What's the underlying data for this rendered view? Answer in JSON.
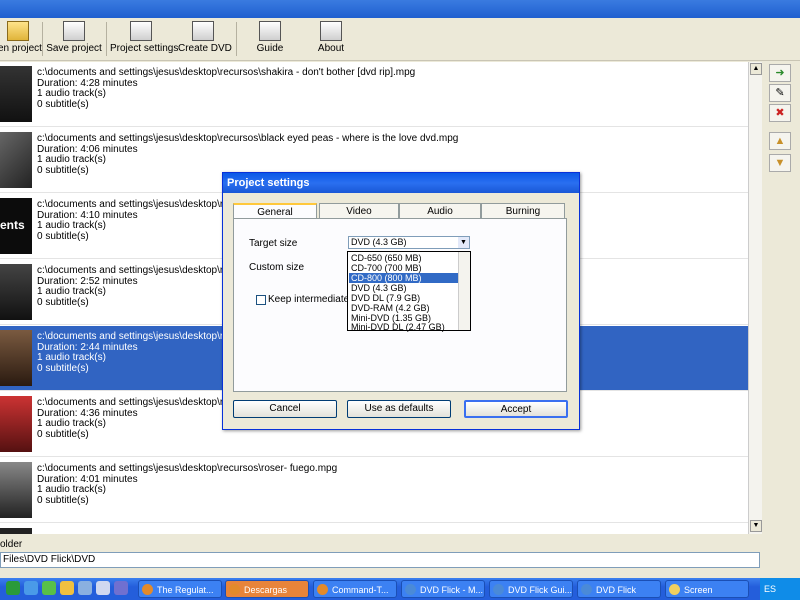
{
  "toolbar": {
    "open_project": "en project",
    "save_project": "Save project",
    "project_settings": "Project settings",
    "create_dvd": "Create DVD",
    "guide": "Guide",
    "about": "About"
  },
  "files": [
    {
      "path": "c:\\documents and settings\\jesus\\desktop\\recursos\\shakira - don't bother [dvd rip].mpg",
      "duration": "Duration: 4:28 minutes",
      "audio": "1 audio track(s)",
      "subs": "0 subtitle(s)"
    },
    {
      "path": "c:\\documents and settings\\jesus\\desktop\\recursos\\black eyed peas - where is the love dvd.mpg",
      "duration": "Duration: 4:06 minutes",
      "audio": "1 audio track(s)",
      "subs": "0 subtitle(s)"
    },
    {
      "path": "c:\\documents and settings\\jesus\\desktop\\recursos\\",
      "duration": "Duration: 4:10 minutes",
      "audio": "1 audio track(s)",
      "subs": "0 subtitle(s)",
      "thumb_text": "ents"
    },
    {
      "path": "c:\\documents and settings\\jesus\\desktop\\recursos\\",
      "duration": "Duration: 2:52 minutes",
      "audio": "1 audio track(s)",
      "subs": "0 subtitle(s)"
    },
    {
      "path": "c:\\documents and settings\\jesus\\desktop\\recursos\\",
      "duration": "Duration: 2:44 minutes",
      "audio": "1 audio track(s)",
      "subs": "0 subtitle(s)"
    },
    {
      "path": "c:\\documents and settings\\jesus\\desktop\\recursos\\",
      "duration": "Duration: 4:36 minutes",
      "audio": "1 audio track(s)",
      "subs": "0 subtitle(s)"
    },
    {
      "path": "c:\\documents and settings\\jesus\\desktop\\recursos\\roser- fuego.mpg",
      "duration": "Duration: 4:01 minutes",
      "audio": "1 audio track(s)",
      "subs": "0 subtitle(s)"
    }
  ],
  "bottom": {
    "folder_label": "older",
    "folder_path": "Files\\DVD Flick\\DVD"
  },
  "dialog": {
    "title": "Project settings",
    "tabs": [
      "General",
      "Video",
      "Audio",
      "Burning"
    ],
    "target_size_label": "Target size",
    "target_size_value": "DVD (4.3 GB)",
    "custom_size_label": "Custom size",
    "keep_label": "Keep intermediate enc",
    "options": [
      "CD-650 (650 MB)",
      "CD-700 (700 MB)",
      "CD-800 (800 MB)",
      "DVD (4.3 GB)",
      "DVD DL (7.9 GB)",
      "DVD-RAM (4.2 GB)",
      "Mini-DVD (1.35 GB)",
      "Mini-DVD DL (2.47 GB)"
    ],
    "selected_option": "CD-800 (800 MB)",
    "cancel": "Cancel",
    "use_defaults": "Use as defaults",
    "accept": "Accept"
  },
  "taskbar": {
    "tasks": [
      "The Regulat...",
      "Descargas",
      "Command-T...",
      "DVD Flick - M...",
      "DVD Flick Gui...",
      "DVD Flick",
      "Screen"
    ],
    "language": "ES"
  },
  "colors": {
    "selection": "#3164c2",
    "taskbar": "#245edb",
    "active_task": "#e8843a"
  }
}
